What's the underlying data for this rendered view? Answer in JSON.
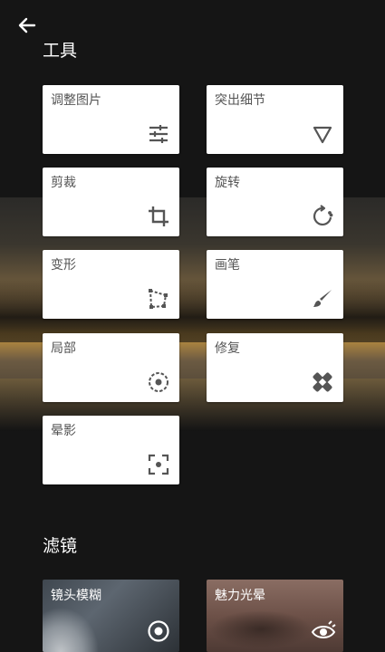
{
  "sections": {
    "tools_title": "工具",
    "filters_title": "滤镜"
  },
  "tools": [
    {
      "label": "调整图片",
      "icon": "tune-sliders-icon"
    },
    {
      "label": "突出细节",
      "icon": "triangle-down-icon"
    },
    {
      "label": "剪裁",
      "icon": "crop-icon"
    },
    {
      "label": "旋转",
      "icon": "rotate-icon"
    },
    {
      "label": "变形",
      "icon": "perspective-icon"
    },
    {
      "label": "画笔",
      "icon": "brush-icon"
    },
    {
      "label": "局部",
      "icon": "selective-icon"
    },
    {
      "label": "修复",
      "icon": "healing-icon"
    },
    {
      "label": "晕影",
      "icon": "vignette-icon"
    }
  ],
  "filters": [
    {
      "label": "镜头模糊",
      "icon": "lens-blur-icon"
    },
    {
      "label": "魅力光晕",
      "icon": "glamour-glow-icon"
    }
  ],
  "colors": {
    "background": "#151515",
    "card": "#ffffff",
    "icon": "#555555"
  }
}
